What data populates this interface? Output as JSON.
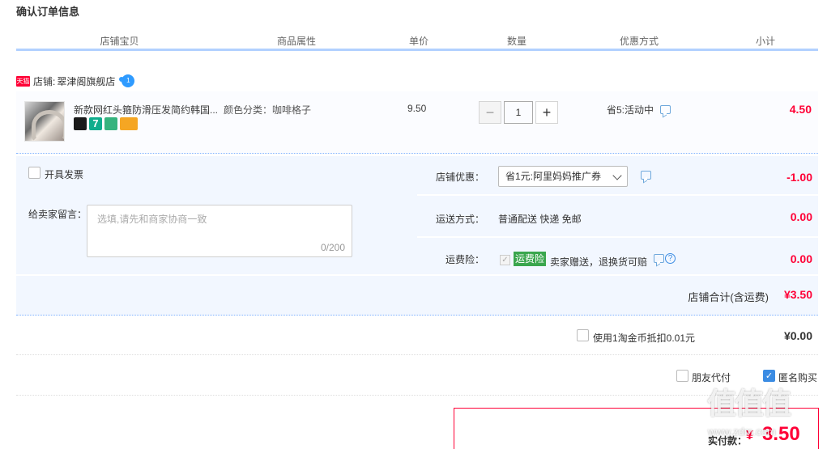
{
  "page": {
    "title": "确认订单信息"
  },
  "columns": [
    "店铺宝贝",
    "商品属性",
    "单价",
    "数量",
    "优惠方式",
    "小计"
  ],
  "shop": {
    "badge": "天猫",
    "label": "店铺:",
    "name": "翠津阁旗舰店",
    "chat_badge": "1"
  },
  "item": {
    "title": "新款网红头箍防滑压发简约韩国...",
    "service_icons": [
      "tmall-cat-icon",
      "seven-day-return-icon",
      "guarantee-icon",
      "card-payment-icon"
    ],
    "seven_label": "7",
    "attribute_label": "颜色分类",
    "attribute_value": "咖啡格子",
    "unit_price": "9.50",
    "quantity": "1",
    "qty_minus": "−",
    "qty_plus": "+",
    "promotion": "省5:活动中",
    "subtotal": "4.50"
  },
  "options": {
    "invoice_label": "开具发票",
    "memo_label": "给卖家留言：",
    "memo_placeholder": "选填,请先和商家协商一致",
    "memo_counter": "0/200",
    "shop_discount_label": "店铺优惠：",
    "shop_discount_selected": "省1元:阿里妈妈推广券",
    "shop_discount_amount": "-1.00",
    "shipping_label": "运送方式：",
    "shipping_value": "普通配送 快递 免邮",
    "shipping_amount": "0.00",
    "insurance_label": "运费险：",
    "insurance_tag": "运费险",
    "insurance_text": "卖家赠送，退换货可赔",
    "insurance_amount": "0.00",
    "help_glyph": "?",
    "shop_total_label": "店铺合计(含运费)",
    "shop_total_value": "¥3.50"
  },
  "coin": {
    "label": "使用1淘金币抵扣0.01元",
    "value": "¥0.00"
  },
  "payment": {
    "friend_pay_label": "朋友代付",
    "anonymous_label": "匿名购买",
    "anonymous_checked": true
  },
  "final": {
    "label": "实付款：",
    "currency": "¥",
    "amount": "3.50"
  },
  "watermark": {
    "text": "值值值",
    "url": "www.zdm.com"
  },
  "colors": {
    "accent": "#ff0036",
    "header_bar": "#b2d1ff",
    "options_bg": "#f2f7ff",
    "link_blue": "#3b8ce3"
  }
}
